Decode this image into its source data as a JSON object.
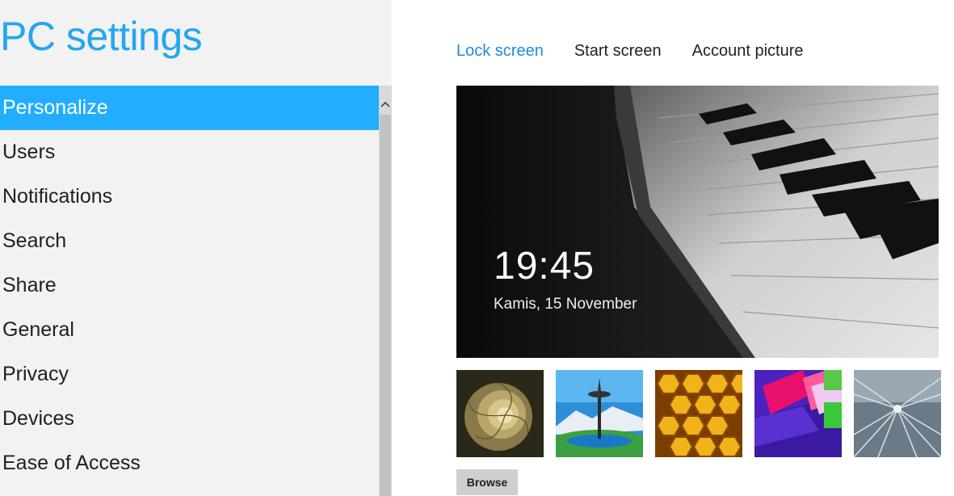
{
  "app_title": "PC settings",
  "nav": {
    "items": [
      {
        "label": "Personalize",
        "selected": true
      },
      {
        "label": "Users"
      },
      {
        "label": "Notifications"
      },
      {
        "label": "Search"
      },
      {
        "label": "Share"
      },
      {
        "label": "General"
      },
      {
        "label": "Privacy"
      },
      {
        "label": "Devices"
      },
      {
        "label": "Ease of Access"
      }
    ]
  },
  "tabs": [
    {
      "label": "Lock screen",
      "active": true
    },
    {
      "label": "Start screen"
    },
    {
      "label": "Account picture"
    }
  ],
  "preview": {
    "time": "19:45",
    "date": "Kamis, 15 November"
  },
  "thumbnails": [
    "nautilus-shell",
    "space-needle",
    "honeycomb",
    "color-blocks",
    "train-tunnel"
  ],
  "browse_label": "Browse",
  "colors": {
    "accent": "#22a7f0",
    "selected_bg": "#22adff",
    "tab_active": "#1a8fd8"
  }
}
